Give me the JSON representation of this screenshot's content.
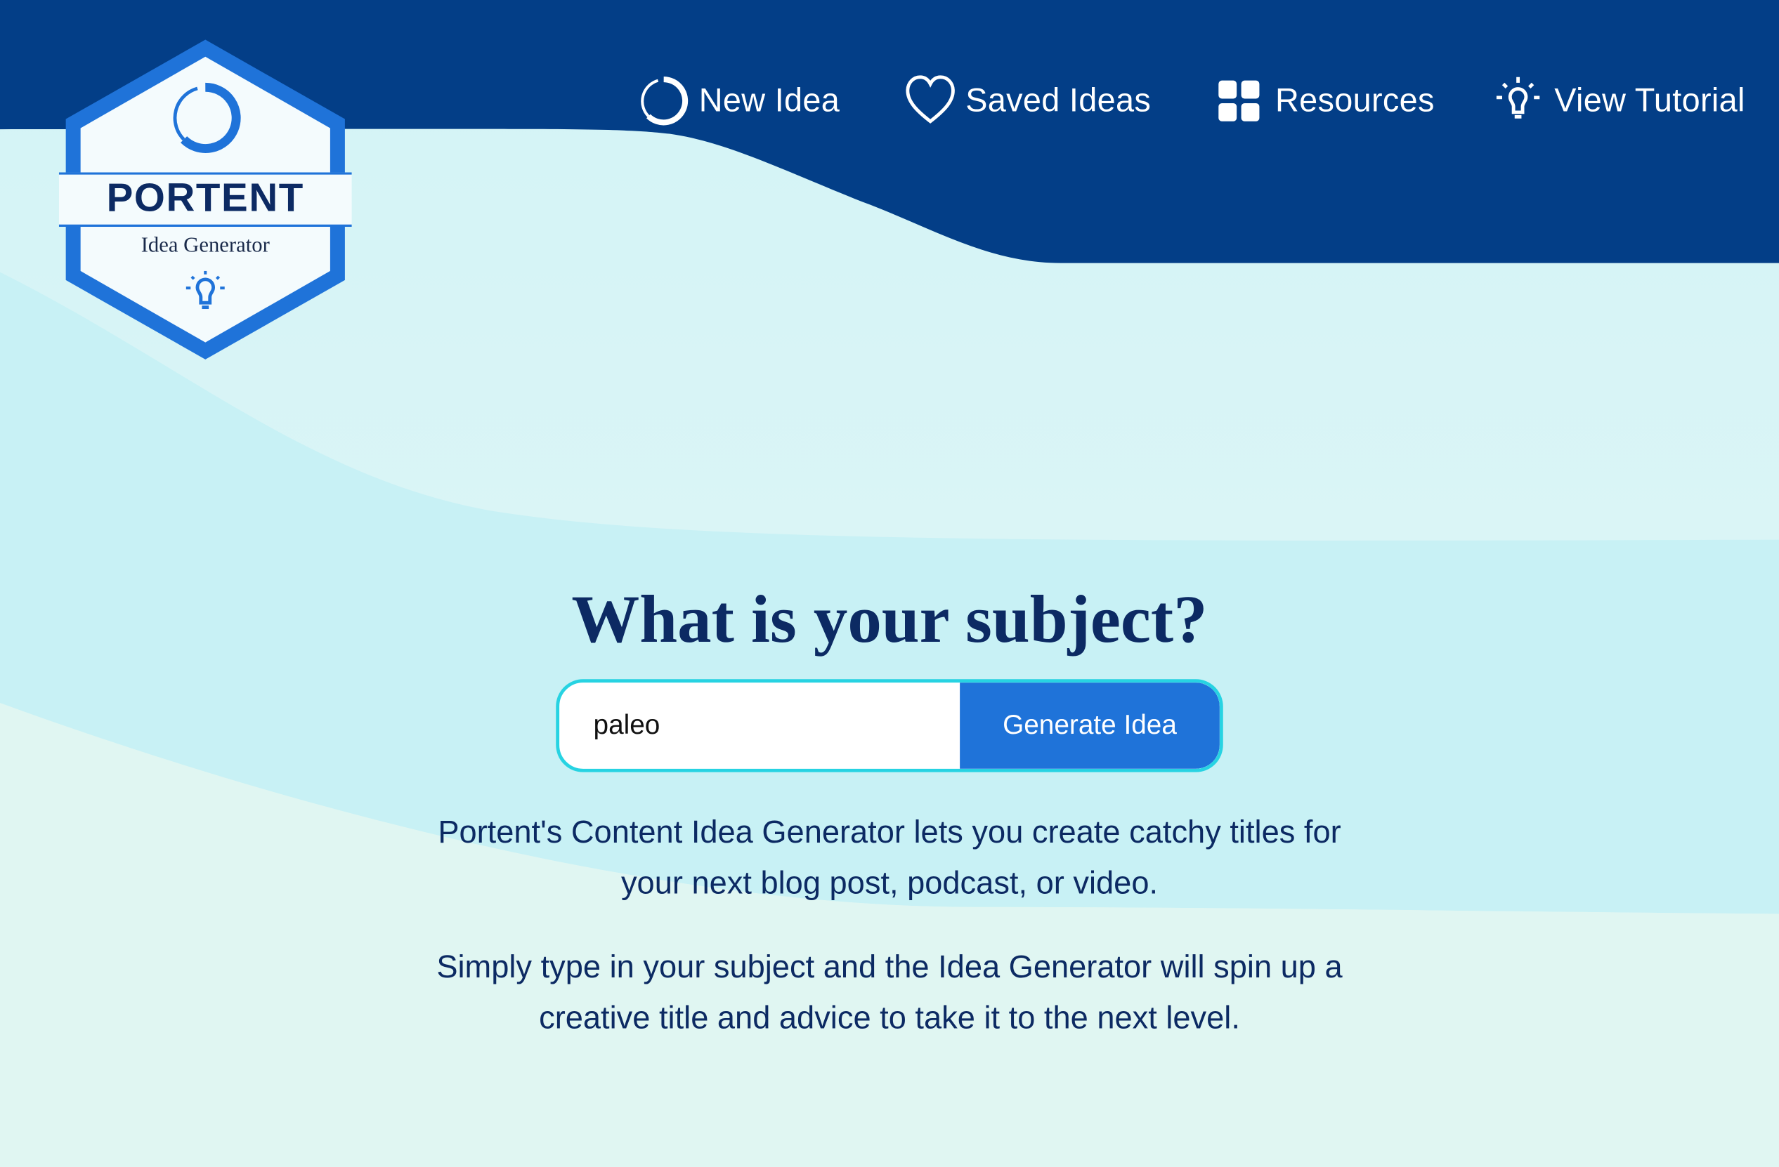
{
  "brand": {
    "name": "PORTENT",
    "tagline": "Idea Generator",
    "colors": {
      "navy": "#033e87",
      "blue": "#1f73d9",
      "cyan": "#27d3e2",
      "text": "#0c2a63"
    }
  },
  "nav": {
    "items": [
      {
        "label": "New Idea",
        "icon": "ring-icon"
      },
      {
        "label": "Saved Ideas",
        "icon": "heart-icon"
      },
      {
        "label": "Resources",
        "icon": "grid-icon"
      },
      {
        "label": "View Tutorial",
        "icon": "lightbulb-icon"
      }
    ]
  },
  "main": {
    "heading": "What is your subject?",
    "search": {
      "value": "paleo",
      "button_label": "Generate Idea"
    },
    "description_1": "Portent's Content Idea Generator lets you create catchy titles for your next blog post, podcast, or video.",
    "description_2": "Simply type in your subject and the Idea Generator will spin up a creative title and advice to take it to the next level."
  }
}
